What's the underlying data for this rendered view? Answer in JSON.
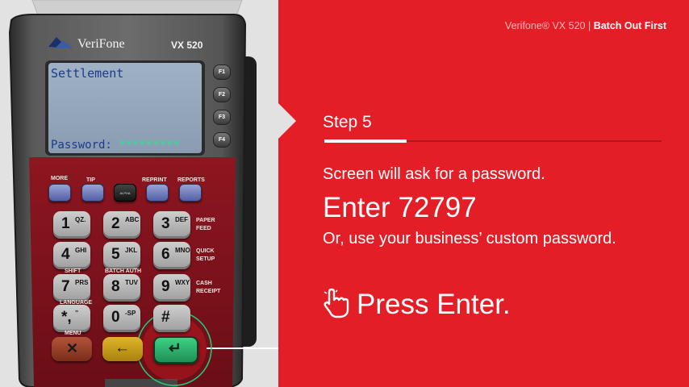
{
  "header": {
    "product": "Verifone® VX 520",
    "separator": "|",
    "section": "Batch Out First"
  },
  "step": {
    "label": "Step 5"
  },
  "instructions": {
    "line1": "Screen will ask for a password.",
    "line2": "Enter 72797",
    "line3": "Or, use your business’ custom password.",
    "press": "Press Enter."
  },
  "terminal": {
    "brand": "VeriFone",
    "model": "VX 520",
    "screen_title": "Settlement",
    "screen_password_label": "Password:",
    "screen_password_mask": "*********",
    "fkeys": [
      "F1",
      "F2",
      "F3",
      "F4"
    ],
    "softkey_labels": [
      "MORE",
      "TIP",
      "ALPHA",
      "REPRINT",
      "REPORTS"
    ],
    "keys": [
      {
        "big": "1",
        "small": "QZ."
      },
      {
        "big": "2",
        "small": "ABC"
      },
      {
        "big": "3",
        "small": "DEF"
      },
      {
        "big": "4",
        "small": "GHI"
      },
      {
        "big": "5",
        "small": "JKL"
      },
      {
        "big": "6",
        "small": "MNO"
      },
      {
        "big": "7",
        "small": "PRS"
      },
      {
        "big": "8",
        "small": "TUV"
      },
      {
        "big": "9",
        "small": "WXY"
      },
      {
        "big": "*,",
        "small": "’’"
      },
      {
        "big": "0",
        "small": "-SP"
      },
      {
        "big": "#",
        "small": ""
      }
    ],
    "key_side_labels": {
      "paper_feed": [
        "PAPER",
        "FEED"
      ],
      "quick_setup": [
        "QUICK",
        "SETUP"
      ],
      "cash_receipt": [
        "CASH",
        "RECEIPT"
      ],
      "shift": "SHIFT",
      "batch_auth": "BATCH AUTH",
      "language": "LANGUAGE",
      "menu": "MENU"
    }
  },
  "colors": {
    "panel_red": "#e31e26",
    "screen_text": "#1f3a8a",
    "mask_green": "#3fd29c",
    "enter_green": "#2eb872",
    "highlight_ring": "#1fd17a"
  },
  "icons": {
    "pointer": "pointer-hand-icon"
  }
}
